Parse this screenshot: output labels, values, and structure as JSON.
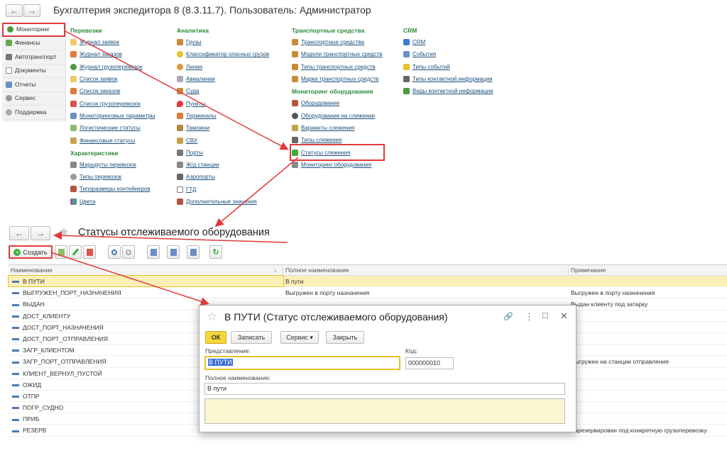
{
  "main_window": {
    "back": "←",
    "forward": "→",
    "title": "Бухгалтерия экспедитора 8 (8.3.11.7). Пользователь: Администратор"
  },
  "sidebar": {
    "items": [
      {
        "label": "Мониторинг",
        "icon": "globe-icon"
      },
      {
        "label": "Финансы",
        "icon": "money-icon"
      },
      {
        "label": "Автотранспорт",
        "icon": "truck-icon"
      },
      {
        "label": "Документы",
        "icon": "document-icon"
      },
      {
        "label": "Отчеты",
        "icon": "report-icon"
      },
      {
        "label": "Сервис",
        "icon": "gear-icon"
      },
      {
        "label": "Поддержка",
        "icon": "support-icon"
      }
    ]
  },
  "columns": {
    "col1": {
      "section1": "Перевозки",
      "links1": [
        "Журнал заявок",
        "Журнал заказов",
        "Журнал грузоперевозок",
        "Список заявок",
        "Список заказов",
        "Список грузоперевозок",
        "Мониторинговые параметры",
        "Логистические статусы",
        "Финансовые статусы"
      ],
      "section2": "Характеристики",
      "links2": [
        "Маршруты перевозок",
        "Типы перевозок",
        "Типоразмеры контейнеров",
        "Цвета"
      ]
    },
    "col2": {
      "section1": "Аналитика",
      "links1": [
        "Грузы",
        "Классификатор опасных грузов",
        "Линии",
        "Авиалинии",
        "Суда",
        "Пункты",
        "Терминалы",
        "Таможни",
        "СВХ",
        "Порты",
        "Ж/д станции",
        "Аэропорты",
        "ГТД",
        "Дополнительные значения"
      ]
    },
    "col3": {
      "section1": "Транспортные средства",
      "links1": [
        "Транспортные средства",
        "Модели транспортных средств",
        "Типы транспортных средств",
        "Марки транспортных средств"
      ],
      "section2": "Мониторинг оборудования",
      "links2": [
        "Оборудование",
        "Оборудование на слежении",
        "Варианты слежения",
        "Типы слежения",
        "Статусы слежения",
        "Мониторинг оборудования"
      ]
    },
    "col4": {
      "section1": "CRM",
      "links1": [
        "CRM",
        "События",
        "Типы событий",
        "Типы контактной информации",
        "Виды контактной информации"
      ]
    }
  },
  "list_window": {
    "back": "←",
    "forward": "→",
    "star": "★",
    "title": "Статусы отслеживаемого оборудования",
    "create_label": "Создать",
    "headers": [
      "Наименование",
      "Полное наименование",
      "Примечание"
    ],
    "sort_arrow": "↓",
    "rows": [
      {
        "name": "В ПУТИ",
        "full": "В пути",
        "note": ""
      },
      {
        "name": "ВЫГРУЖЕН_ПОРТ_НАЗНАЧЕНИЯ",
        "full": "Выгружен в порту назначения",
        "note": "Выгружен в порту назначения"
      },
      {
        "name": "ВЫДАН",
        "full": "",
        "note": "Выдан клиенту под затарку"
      },
      {
        "name": "ДОСТ_КЛИЕНТУ",
        "full": "",
        "note": ""
      },
      {
        "name": "ДОСТ_ПОРТ_НАЗНАЧЕНИЯ",
        "full": "",
        "note": ""
      },
      {
        "name": "ДОСТ_ПОРТ_ОТПРАВЛЕНИЯ",
        "full": "",
        "note": ""
      },
      {
        "name": "ЗАГР_КЛИЕНТОМ",
        "full": "",
        "note": ""
      },
      {
        "name": "ЗАГР_ПОРТ_ОТПРАВЛЕНИЯ",
        "full": "",
        "note": "Выгружен на станции отправления"
      },
      {
        "name": "КЛИЕНТ_ВЕРНУЛ_ПУСТОЙ",
        "full": "",
        "note": ""
      },
      {
        "name": "ОЖИД",
        "full": "",
        "note": ""
      },
      {
        "name": "ОТПР",
        "full": "",
        "note": ""
      },
      {
        "name": "ПОГР_СУДНО",
        "full": "",
        "note": ""
      },
      {
        "name": "ПРИБ",
        "full": "",
        "note": ""
      },
      {
        "name": "РЕЗЕРВ",
        "full": "",
        "note": "Зарезервирован под конкретную грузоперевозку"
      }
    ]
  },
  "dialog": {
    "star": "☆",
    "title": "В ПУТИ (Статус отслеживаемого оборудования)",
    "link_icon": "🔗",
    "more_icon": "⋮",
    "max_icon": "□",
    "close_icon": "✕",
    "ok": "ОК",
    "save": "Записать",
    "service": "Сервис ▾",
    "close": "Закрыть",
    "repr_label": "Представление:",
    "repr_value": "В ПУТИ",
    "code_label": "Код:",
    "code_value": "000000010",
    "full_label": "Полное наименование:",
    "full_value": "В пути",
    "comment_value": ""
  },
  "colors": {
    "accent_red": "#e03a3a",
    "section_green": "#2a8a3c",
    "link_blue": "#1a4f7a",
    "selection_yellow": "#fbefb8",
    "ok_yellow": "#f5d838"
  }
}
